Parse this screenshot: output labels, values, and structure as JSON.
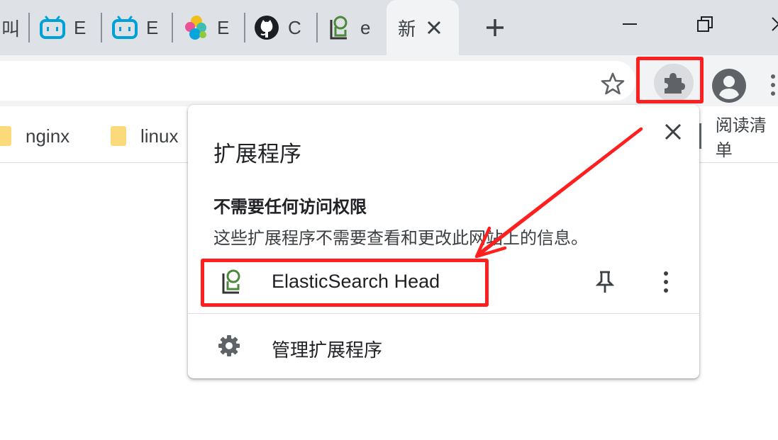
{
  "tabs": [
    {
      "title": "叫",
      "icon": "text-favicon"
    },
    {
      "title": "E",
      "icon": "bilibili-icon"
    },
    {
      "title": "E",
      "icon": "bilibili-icon"
    },
    {
      "title": "E",
      "icon": "elastic-icon"
    },
    {
      "title": "C",
      "icon": "github-icon"
    },
    {
      "title": "e",
      "icon": "elasticsearch-head-icon"
    },
    {
      "title": "新",
      "icon": "none",
      "active": true
    }
  ],
  "bookmarks": [
    {
      "label": "nginx",
      "icon": "folder-icon"
    },
    {
      "label": "linux",
      "icon": "folder-icon"
    }
  ],
  "reading_list": "阅读清单",
  "popup": {
    "title": "扩展程序",
    "section_heading": "不需要任何访问权限",
    "section_desc": "这些扩展程序不需要查看和更改此网站上的信息。",
    "extension_name": "ElasticSearch Head",
    "manage_label": "管理扩展程序"
  },
  "colors": {
    "highlight": "#ff1f1f",
    "bilibili": "#00a1d6"
  }
}
